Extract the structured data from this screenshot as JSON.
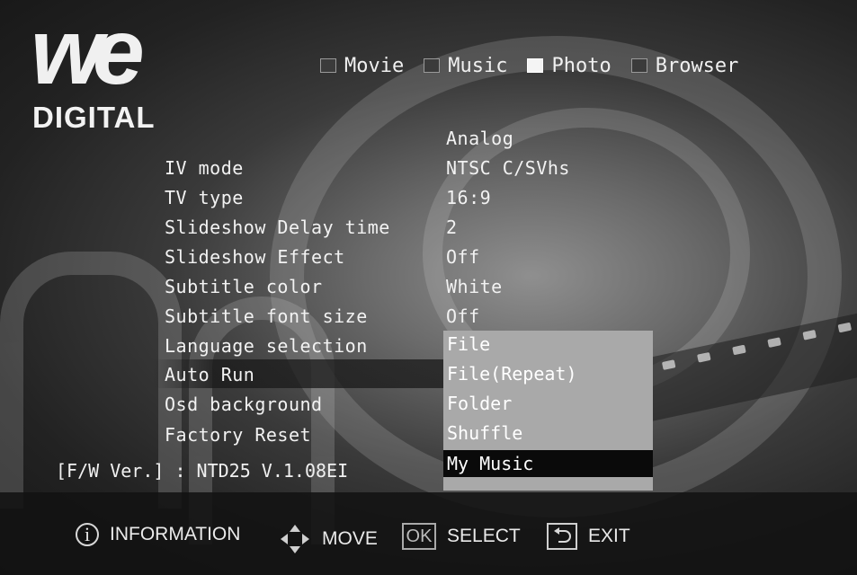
{
  "logo": {
    "we": "we",
    "digital": "DIGITAL"
  },
  "top_nav": [
    {
      "label": "Movie",
      "active": false
    },
    {
      "label": "Music",
      "active": false
    },
    {
      "label": "Photo",
      "active": true
    },
    {
      "label": "Browser",
      "active": false
    }
  ],
  "settings": {
    "header_value": "Analog",
    "rows": [
      {
        "label": "IV mode",
        "value": "NTSC C/SVhs"
      },
      {
        "label": "TV type",
        "value": "16:9"
      },
      {
        "label": "Slideshow Delay time",
        "value": "2"
      },
      {
        "label": "Slideshow Effect",
        "value": "Off"
      },
      {
        "label": "Subtitle color",
        "value": "White"
      },
      {
        "label": "Subtitle font size",
        "value": "Off"
      },
      {
        "label": "Language selection",
        "value": ""
      },
      {
        "label": "Auto Run",
        "value": ""
      },
      {
        "label": "Osd background",
        "value": ""
      },
      {
        "label": "Factory Reset",
        "value": ""
      }
    ]
  },
  "dropdown": {
    "options": [
      "File",
      "File(Repeat)",
      "Folder",
      "Shuffle",
      "My Music"
    ],
    "selected": "My Music"
  },
  "firmware": "[F/W Ver.] : NTD25 V.1.08EI",
  "hints": {
    "information": "INFORMATION",
    "move": "MOVE",
    "ok_icon": "OK",
    "select": "SELECT",
    "exit": "EXIT"
  },
  "colors": {
    "dropdown_bg": "#a9a9a9",
    "selected_bg": "#0a0a0a",
    "bottom_bar": "#121212"
  }
}
